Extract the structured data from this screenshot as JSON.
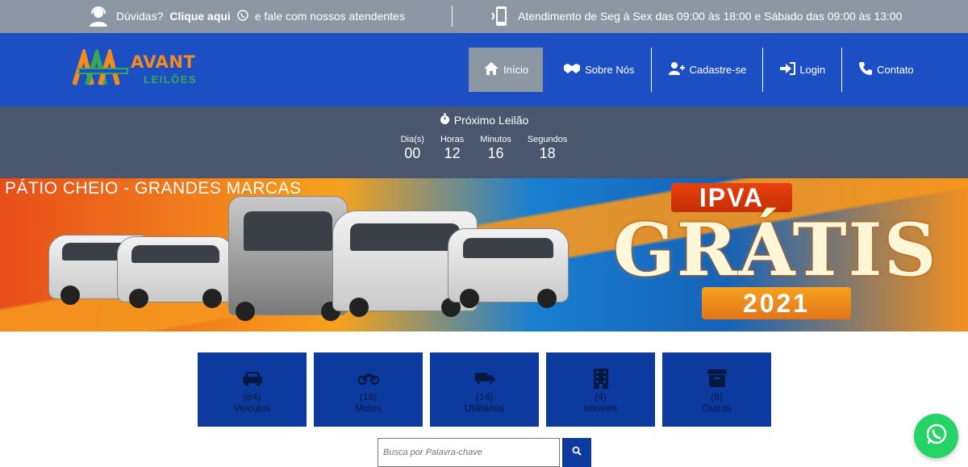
{
  "topbar": {
    "doubts_prefix": "Dúvidas?",
    "click_here": "Clique aqui",
    "doubts_suffix": "e fale com nossos atendentes",
    "hours": "Atendimento de Seg à Sex das 09:00 às 18:00 e Sábado das 09:00 às 13:00"
  },
  "logo": {
    "brand": "AVANT",
    "sub": "LEILÕES"
  },
  "menu": {
    "items": [
      {
        "label": "Início",
        "icon": "home-icon"
      },
      {
        "label": "Sobre Nós",
        "icon": "handshake-icon"
      },
      {
        "label": "Cadastre-se",
        "icon": "user-plus-icon"
      },
      {
        "label": "Login",
        "icon": "login-icon"
      },
      {
        "label": "Contato",
        "icon": "phone-icon"
      }
    ]
  },
  "countdown": {
    "title": "Próximo Leilão",
    "units": [
      {
        "label": "Dia(s)",
        "value": "00"
      },
      {
        "label": "Horas",
        "value": "12"
      },
      {
        "label": "Minutos",
        "value": "16"
      },
      {
        "label": "Segundos",
        "value": "18"
      }
    ]
  },
  "banner": {
    "headline": "PÁTIO CHEIO - GRANDES MARCAS",
    "promo_top": "IPVA",
    "promo_main": "GRÁTIS",
    "promo_year": "2021"
  },
  "categories": [
    {
      "count": "(84)",
      "name": "Veículos",
      "icon": "car-icon"
    },
    {
      "count": "(19)",
      "name": "Motos",
      "icon": "motorcycle-icon"
    },
    {
      "count": "(14)",
      "name": "Utilitários",
      "icon": "truck-icon"
    },
    {
      "count": "(4)",
      "name": "Imoveis",
      "icon": "building-icon"
    },
    {
      "count": "(8)",
      "name": "Outros",
      "icon": "box-icon"
    }
  ],
  "search": {
    "placeholder": "Busca por Palavra-chave"
  },
  "colors": {
    "nav": "#1d4fc4",
    "topbar": "#8c97a3",
    "countdown": "#4a566d",
    "category": "#0d3a9e",
    "whatsapp": "#25d366"
  }
}
